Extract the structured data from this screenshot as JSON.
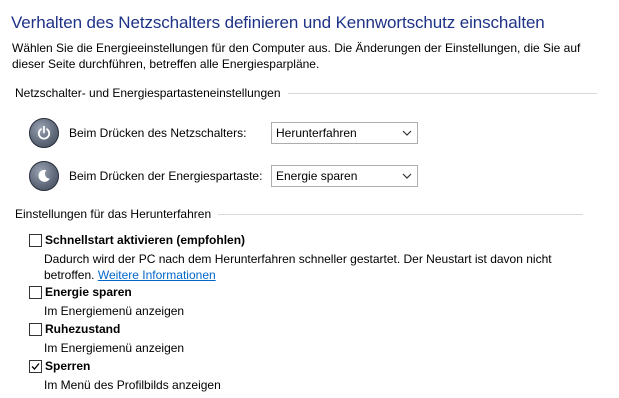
{
  "page": {
    "title": "Verhalten des Netzschalters definieren und Kennwortschutz einschalten",
    "intro": "Wählen Sie die Energieeinstellungen für den Computer aus. Die Änderungen der Einstellungen, die Sie auf dieser Seite durchführen, betreffen alle Energiesparpläne."
  },
  "button_settings": {
    "header": "Netzschalter- und Energiespartasteneinstellungen",
    "power_button": {
      "label": "Beim Drücken des Netzschalters:",
      "value": "Herunterfahren",
      "icon": "power-icon"
    },
    "sleep_button": {
      "label": "Beim Drücken der Energiespartaste:",
      "value": "Energie sparen",
      "icon": "sleep-moon-icon"
    }
  },
  "shutdown_settings": {
    "header": "Einstellungen für das Herunterfahren",
    "items": [
      {
        "label": "Schnellstart aktivieren (empfohlen)",
        "description": "Dadurch wird der PC nach dem Herunterfahren schneller gestartet. Der Neustart ist davon nicht betroffen.",
        "link": "Weitere Informationen",
        "checked": false
      },
      {
        "label": "Energie sparen",
        "description": "Im Energiemenü anzeigen",
        "checked": false
      },
      {
        "label": "Ruhezustand",
        "description": "Im Energiemenü anzeigen",
        "checked": false
      },
      {
        "label": "Sperren",
        "description": "Im Menü des Profilbilds anzeigen",
        "checked": true
      }
    ]
  },
  "colors": {
    "title": "#1e3287",
    "link": "#0066cc",
    "divider": "#d9d9d9"
  }
}
